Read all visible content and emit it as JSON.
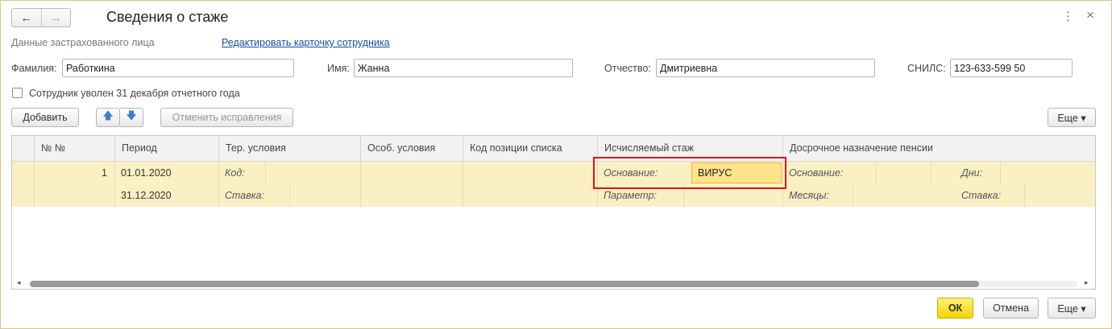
{
  "window": {
    "title": "Сведения о стаже",
    "nav_back_icon": "←",
    "nav_forward_icon": "→",
    "menu_icon": "⋮",
    "close_icon": "×"
  },
  "insured": {
    "section_label": "Данные застрахованного лица",
    "edit_link": "Редактировать карточку сотрудника",
    "surname_label": "Фамилия:",
    "surname_value": "Работкина",
    "name_label": "Имя:",
    "name_value": "Жанна",
    "patronymic_label": "Отчество:",
    "patronymic_value": "Дмитриевна",
    "snils_label": "СНИЛС:",
    "snils_value": "123-633-599 50",
    "dismissed_label": "Сотрудник уволен 31 декабря отчетного года",
    "dismissed_checked": false
  },
  "toolbar": {
    "add_label": "Добавить",
    "up_icon": "🡅",
    "down_icon": "🡇",
    "cancel_fixes_label": "Отменить исправления",
    "more_label": "Еще ▾"
  },
  "table": {
    "columns": [
      "№ №",
      "Период",
      "Тер. условия",
      "Особ. условия",
      "Код позиции списка",
      "Исчисляемый стаж",
      "Досрочное назначение пенсии"
    ],
    "row": {
      "number": "1",
      "period_start": "01.01.2020",
      "period_end": "31.12.2020",
      "ter_code_label": "Код:",
      "ter_rate_label": "Ставка:",
      "stazh_basis_label": "Основание:",
      "stazh_basis_value": "ВИРУС",
      "stazh_param_label": "Параметр:",
      "pension_basis_label": "Основание:",
      "pension_days_label": "Дни:",
      "pension_months_label": "Месяцы:",
      "pension_rate_label": "Ставка:"
    },
    "scroll_left_icon": "◂",
    "scroll_right_icon": "▸"
  },
  "footer": {
    "ok_label": "ОК",
    "cancel_label": "Отмена",
    "more_label": "Еще ▾"
  },
  "colors": {
    "row_highlight": "#fbf0c3",
    "selected_cell": "#ffe48a",
    "annotation_box": "#e0101a",
    "primary_button": "#f2d600",
    "link": "#1a4fa1"
  }
}
